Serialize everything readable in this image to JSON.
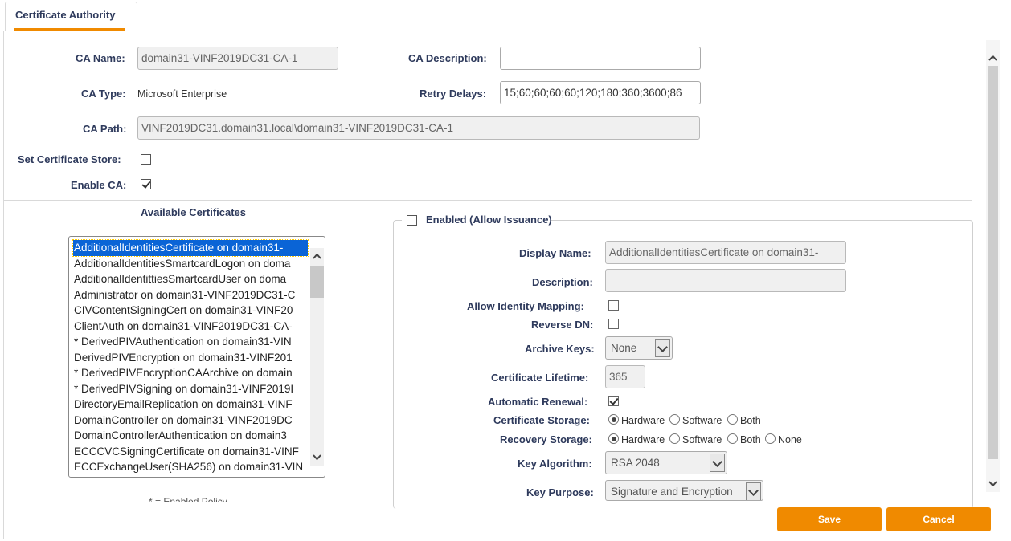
{
  "tab": {
    "label": "Certificate Authority"
  },
  "ca": {
    "name_label": "CA Name:",
    "name_value": "domain31-VINF2019DC31-CA-1",
    "description_label": "CA Description:",
    "description_value": "",
    "type_label": "CA Type:",
    "type_value": "Microsoft Enterprise",
    "retry_label": "Retry Delays:",
    "retry_value": "15;60;60;60;60;120;180;360;3600;86",
    "path_label": "CA Path:",
    "path_value": "VINF2019DC31.domain31.local\\domain31-VINF2019DC31-CA-1",
    "store_label": "Set Certificate Store:",
    "store_checked": false,
    "enable_label": "Enable CA:",
    "enable_checked": true
  },
  "certificates": {
    "heading": "Available Certificates",
    "items": [
      "AdditionalIdentitiesCertificate on domain31-",
      "AdditionalIdentitiesSmartcardLogon on doma",
      "AdditionalIdentittiesSmartcardUser on doma",
      "Administrator on domain31-VINF2019DC31-C",
      "CIVContentSigningCert on domain31-VINF20",
      "ClientAuth on domain31-VINF2019DC31-CA-",
      "* DerivedPIVAuthentication on domain31-VIN",
      "DerivedPIVEncryption on domain31-VINF201",
      "* DerivedPIVEncryptionCAArchive on domain",
      "* DerivedPIVSigning on domain31-VINF2019I",
      "DirectoryEmailReplication on domain31-VINF",
      "DomainController on domain31-VINF2019DC",
      "DomainControllerAuthentication on domain3",
      "ECCCVCSigningCertificate on domain31-VINF",
      "ECCExchangeUser(SHA256) on domain31-VIN"
    ],
    "selected_index": 0,
    "footnote": "* = Enabled Policy"
  },
  "template": {
    "enabled_label": "Enabled (Allow Issuance)",
    "display_name_label": "Display Name:",
    "display_name_value": "AdditionalIdentitiesCertificate on domain31-",
    "description_label": "Description:",
    "description_value": "",
    "identity_mapping_label": "Allow Identity Mapping:",
    "reverse_dn_label": "Reverse DN:",
    "archive_keys_label": "Archive Keys:",
    "archive_keys_value": "None",
    "lifetime_label": "Certificate Lifetime:",
    "lifetime_value": "365",
    "renewal_label": "Automatic Renewal:",
    "cert_storage_label": "Certificate Storage:",
    "recovery_storage_label": "Recovery Storage:",
    "opt_hardware": "Hardware",
    "opt_software": "Software",
    "opt_both": "Both",
    "opt_none": "None",
    "key_algorithm_label": "Key Algorithm:",
    "key_algorithm_value": "RSA 2048",
    "key_purpose_label": "Key Purpose:",
    "key_purpose_value": "Signature and Encryption"
  },
  "buttons": {
    "save": "Save",
    "cancel": "Cancel"
  },
  "colors": {
    "accent": "#f08a00",
    "label": "#2e3a5c",
    "selection": "#0a64d6"
  }
}
